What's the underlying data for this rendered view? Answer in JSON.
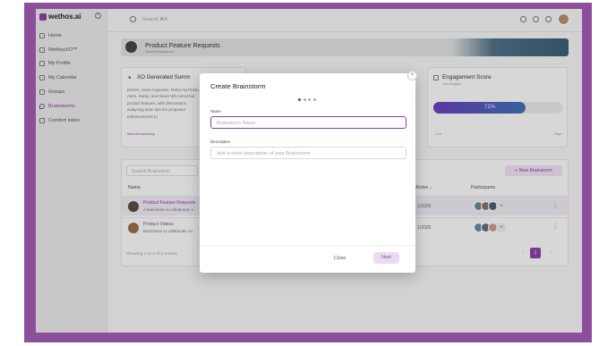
{
  "app": {
    "logo_text": "wethos.ai"
  },
  "sidebar": {
    "items": [
      {
        "label": "Home",
        "icon": "home-icon",
        "active": false
      },
      {
        "label": "WethosXO™",
        "icon": "xo-icon",
        "active": false
      },
      {
        "label": "My Profile",
        "icon": "profile-icon",
        "active": false
      },
      {
        "label": "My Calendar",
        "icon": "calendar-icon",
        "active": false
      },
      {
        "label": "Groups",
        "icon": "groups-icon",
        "active": false
      },
      {
        "label": "Brainstorms",
        "icon": "brainstorm-icon",
        "active": true
      },
      {
        "label": "Comfort Index",
        "icon": "comfort-icon",
        "active": false
      }
    ]
  },
  "topbar": {
    "search_placeholder": "Search   ⌘K"
  },
  "banner": {
    "title": "Product Feature Requests",
    "subtitle": "Selected Brainstorm"
  },
  "xo_card": {
    "title": "XO Generated Summ",
    "body": "Darren, Sean Augustine, Rahul Ag Prash, Aden, Saran, and Stuart Wh numerical product features, with discussions, analyzing team dyn the proposed enhancements fu",
    "link": "View full summary"
  },
  "engagement": {
    "title": "Engagement Score",
    "subtitle": "Live Analysis",
    "value_label": "71%",
    "value": 0.71,
    "low": "Low",
    "high": "High"
  },
  "table": {
    "search_placeholder": "Search Brainstorm",
    "new_button": "New Brainstorm",
    "headers": {
      "name": "Name",
      "last_active": "st Active ↓",
      "participants": "Participants"
    },
    "rows": [
      {
        "name": "Product Feature Requests",
        "desc": "A brainstorm to collaborate o",
        "date": "1/2025",
        "extra": "+5"
      },
      {
        "name": "Product Videos",
        "desc": "Brainstorm to collaborate on",
        "date": "1/2025",
        "extra": "+5"
      }
    ],
    "footer": "Showing 1 to 2 of 2 entries",
    "page": "1",
    "prev": "‹",
    "next": "›"
  },
  "modal": {
    "title": "Create Brainstorm",
    "close_symbol": "×",
    "name_label": "Name",
    "name_placeholder": "Brainstorm Name",
    "desc_label": "Description",
    "desc_placeholder": "Add a short description of your Brainstorm",
    "close_button": "Close",
    "next_button": "Next"
  },
  "colors": {
    "accent": "#8a3fa3",
    "frame": "#8d4f9c"
  }
}
